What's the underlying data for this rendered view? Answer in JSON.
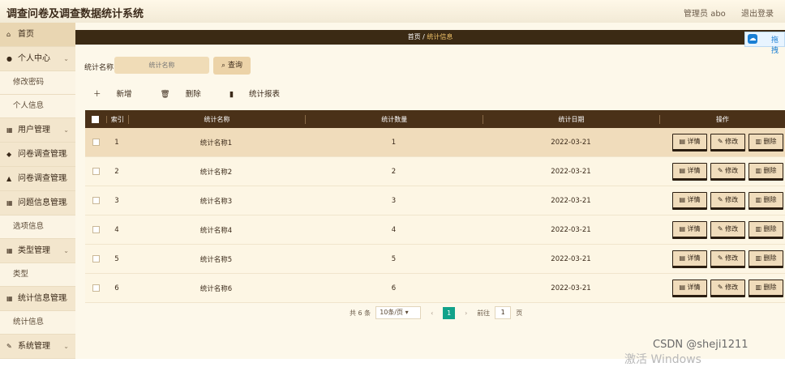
{
  "header": {
    "title": "调查问卷及调查数据统计系统",
    "admin": "管理员 abo",
    "logout": "退出登录"
  },
  "sidebar": {
    "items": [
      {
        "label": "首页",
        "icon": "home-icon",
        "glyph": "⌂",
        "type": "item",
        "chevron": false
      },
      {
        "label": "个人中心",
        "icon": "user-icon",
        "glyph": "●",
        "type": "item",
        "chevron": true
      },
      {
        "label": "修改密码",
        "type": "sub"
      },
      {
        "label": "个人信息",
        "type": "sub"
      },
      {
        "label": "用户管理",
        "icon": "users-icon",
        "glyph": "▦",
        "type": "item",
        "chevron": true
      },
      {
        "label": "问卷调查管理",
        "icon": "survey-icon",
        "glyph": "◆",
        "type": "item",
        "chevron": true
      },
      {
        "label": "问卷调查管理",
        "icon": "bank-icon",
        "glyph": "▲",
        "type": "item",
        "chevron": true
      },
      {
        "label": "问题信息管理",
        "icon": "grid-icon",
        "glyph": "▦",
        "type": "item",
        "chevron": true
      },
      {
        "label": "选项信息",
        "type": "sub"
      },
      {
        "label": "类型管理",
        "icon": "category-icon",
        "glyph": "▦",
        "type": "item",
        "chevron": true
      },
      {
        "label": "类型",
        "type": "sub"
      },
      {
        "label": "统计信息管理",
        "icon": "stats-icon",
        "glyph": "▦",
        "type": "item",
        "chevron": true
      },
      {
        "label": "统计信息",
        "type": "sub"
      },
      {
        "label": "系统管理",
        "icon": "wrench-icon",
        "glyph": "✎",
        "type": "item",
        "chevron": true
      }
    ]
  },
  "breadcrumb": {
    "home": "首页",
    "sep": "/",
    "current": "统计信息"
  },
  "helper": {
    "label": "拖拽"
  },
  "search": {
    "label": "统计名称",
    "placeholder": "统计名称",
    "button": "查询"
  },
  "actions": {
    "add": "新增",
    "delete": "删除",
    "report": "统计报表"
  },
  "table": {
    "columns": [
      "索引",
      "统计名称",
      "统计数量",
      "统计日期",
      "操作"
    ],
    "rows": [
      {
        "idx": "1",
        "name": "统计名称1",
        "num": "1",
        "date": "2022-03-21"
      },
      {
        "idx": "2",
        "name": "统计名称2",
        "num": "2",
        "date": "2022-03-21"
      },
      {
        "idx": "3",
        "name": "统计名称3",
        "num": "3",
        "date": "2022-03-21"
      },
      {
        "idx": "4",
        "name": "统计名称4",
        "num": "4",
        "date": "2022-03-21"
      },
      {
        "idx": "5",
        "name": "统计名称5",
        "num": "5",
        "date": "2022-03-21"
      },
      {
        "idx": "6",
        "name": "统计名称6",
        "num": "6",
        "date": "2022-03-21"
      }
    ],
    "ops": {
      "detail": "详情",
      "edit": "修改",
      "remove": "删除"
    }
  },
  "pager": {
    "total": "共 6 条",
    "size": "10条/页",
    "current": "1",
    "goto_prefix": "前往",
    "goto_value": "1",
    "goto_suffix": "页"
  },
  "watermark": {
    "csdn": "CSDN @sheji1211",
    "os": "激活 Windows"
  }
}
